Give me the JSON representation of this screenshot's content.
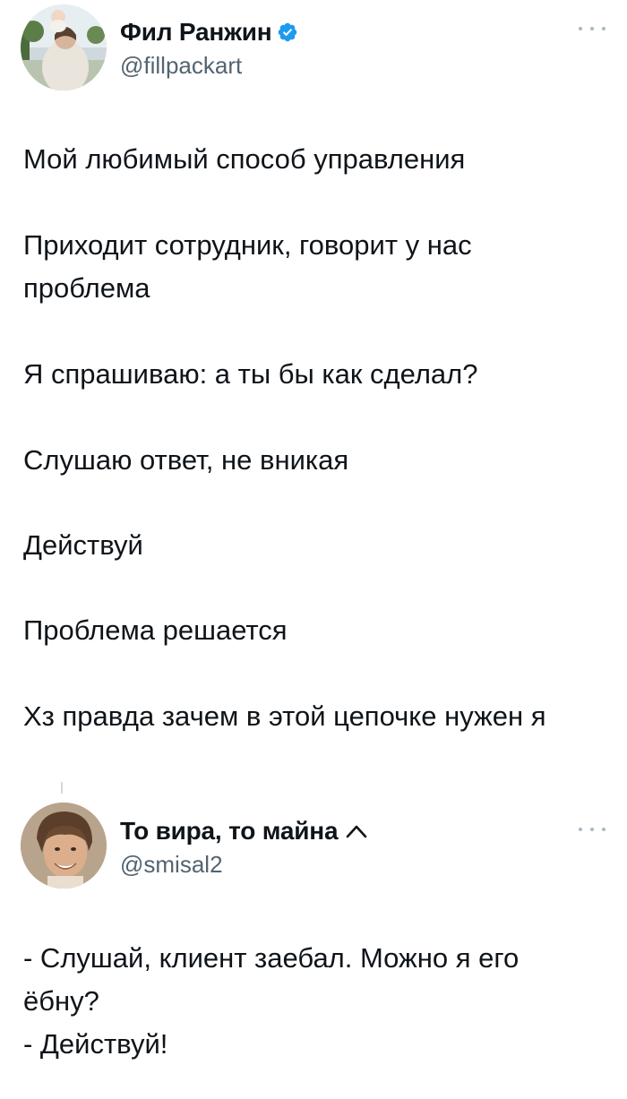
{
  "tweets": [
    {
      "author": {
        "display_name": "Фил Ранжин",
        "handle": "@fillpackart",
        "verified": true,
        "verified_color": "#1d9bf0"
      },
      "paragraphs": [
        "Мой любимый способ управления",
        "Приходит сотрудник, говорит у нас проблема",
        "Я спрашиваю: а ты бы как сделал?",
        "Слушаю ответ, не вникая",
        "Действуй",
        "Проблема решается",
        "Хз правда зачем в этой цепочке нужен я"
      ]
    },
    {
      "author": {
        "display_name": "То вира, то майна",
        "handle": "@smisal2",
        "name_icon": "caret-up-icon"
      },
      "lines": [
        "- Слушай, клиент заебал. Можно я его ёбну?",
        "- Действуй!"
      ]
    }
  ],
  "icons": {
    "more": "more-horizontal-icon",
    "verified": "verified-badge-icon"
  }
}
